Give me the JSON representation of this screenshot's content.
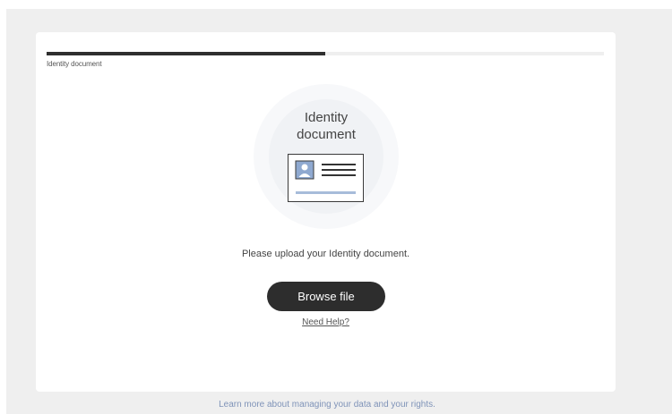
{
  "progress": {
    "step_label": "Identity document",
    "fraction": 0.5
  },
  "illustration": {
    "title_line1": "Identity",
    "title_line2": "document",
    "icon": "id-card-icon"
  },
  "upload": {
    "prompt": "Please upload your Identity document.",
    "browse_label": "Browse file",
    "help_label": "Need Help?"
  },
  "footer": {
    "data_rights_link": "Learn more about managing your data and your rights."
  },
  "colors": {
    "button_bg": "#2d2d2d",
    "progress_fill": "#2f2f2f",
    "card_accent": "#8fa9d0",
    "link": "#7f93b8"
  }
}
